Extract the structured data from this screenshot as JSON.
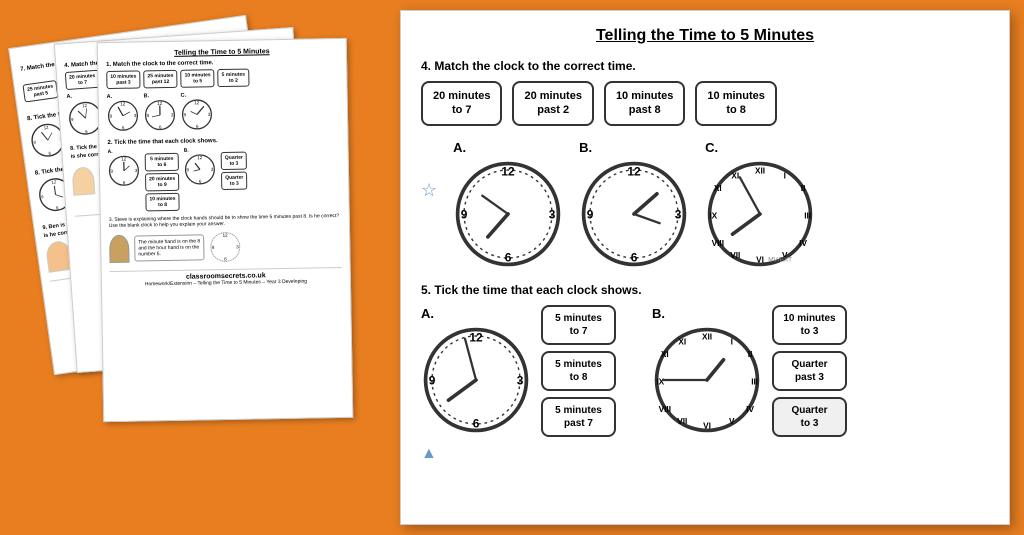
{
  "background": {
    "color": "#e87e20"
  },
  "main_page": {
    "title": "Telling the Time to 5 Minutes",
    "section4": {
      "label": "4. Match the clock to the correct time.",
      "time_options": [
        {
          "text": "20 minutes\nto 7"
        },
        {
          "text": "20 minutes\npast 2"
        },
        {
          "text": "10 minutes\npast 8"
        },
        {
          "text": "10 minutes\nto 8"
        }
      ],
      "clocks": [
        {
          "letter": "A.",
          "type": "arabic"
        },
        {
          "letter": "B.",
          "type": "arabic"
        },
        {
          "letter": "C.",
          "type": "roman"
        }
      ]
    },
    "section5": {
      "label": "5. Tick the time that each clock shows.",
      "clock_a": {
        "letter": "A.",
        "options": [
          "5 minutes\nto 7",
          "5 minutes\nto 8",
          "5 minutes\npast 7"
        ]
      },
      "clock_b": {
        "letter": "B.",
        "options": [
          "10 minutes\nto 3",
          "Quarter\npast 3",
          "Quarter\nto 3"
        ]
      }
    }
  },
  "bg_page3": {
    "title": "Telling the Time to 5 Minutes",
    "section1": "1. Match the clock to the correct time.",
    "time_boxes_1": [
      "10 minutes\npast 3",
      "25 minutes\npast 12",
      "10 minutes\nto 5",
      "5 minutes\nto 2"
    ],
    "section2": "2. Tick the time that each clock shows.",
    "section2_options_a": [
      "5 minutes\nto 6",
      "20 minutes\nto 9",
      "10 minutes\nto 8"
    ],
    "section2_options_b": [
      "Quarter\nto 3",
      "Quarter\nto 3"
    ],
    "section3": "3. Steve is explaining where the clock hands should be to show the time 5 minutes past 8. Is he correct? Use the blank clock to help you explain your answer.",
    "speech_bubble": "The minute hand is on the 8\nand the hour hand is on the\nnumber 5.",
    "website": "classroomsecrets.co.uk",
    "footer": "Homework/Extension – Telling the Time to 5 Minutes – Year 3 Developing"
  }
}
